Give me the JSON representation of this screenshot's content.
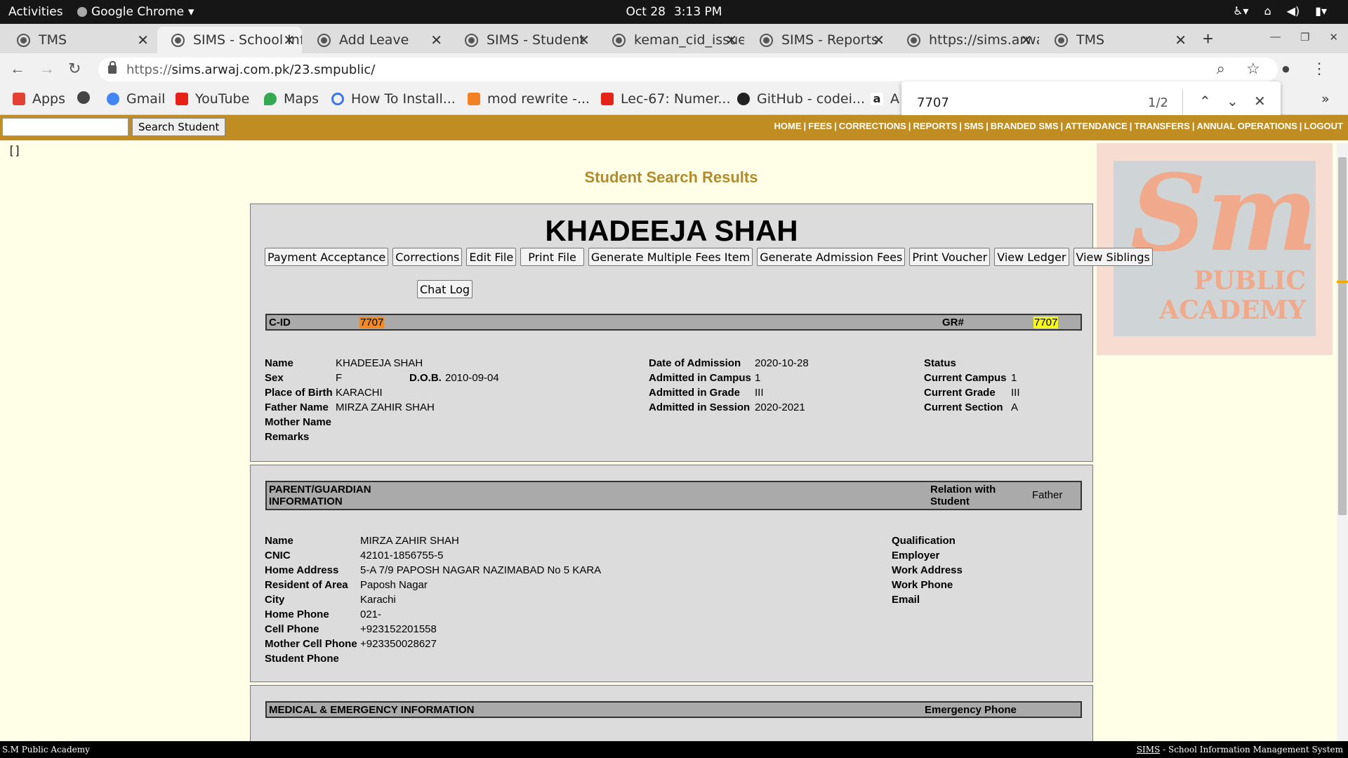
{
  "system": {
    "activities": "Activities",
    "app": "Google Chrome",
    "date": "Oct 28",
    "time": "3:13 PM"
  },
  "tabs": [
    {
      "title": "TMS"
    },
    {
      "title": "SIMS - School Information Management System"
    },
    {
      "title": "Add Leave"
    },
    {
      "title": "SIMS - Student"
    },
    {
      "title": "keman_cid_issue"
    },
    {
      "title": "SIMS - Reports"
    },
    {
      "title": "https://sims.arwaj"
    },
    {
      "title": "TMS"
    }
  ],
  "address": {
    "prefix": "https://",
    "url": "sims.arwaj.com.pk/23.smpublic/"
  },
  "bookmarks": [
    {
      "label": "Apps",
      "icon": "apps-grid-icon",
      "color": "#e34133"
    },
    {
      "label": "",
      "icon": "globe-icon",
      "color": "#444444"
    },
    {
      "label": "Gmail",
      "icon": "google-g-icon",
      "color": "#4285f4"
    },
    {
      "label": "YouTube",
      "icon": "youtube-icon",
      "color": "#e62117"
    },
    {
      "label": "Maps",
      "icon": "maps-pin-icon",
      "color": "#34a853"
    },
    {
      "label": "How To Install...",
      "icon": "loading-icon",
      "color": "#3b78e7"
    },
    {
      "label": "mod rewrite -...",
      "icon": "stack-icon",
      "color": "#f48024"
    },
    {
      "label": "Lec-67: Numer...",
      "icon": "youtube-icon",
      "color": "#e62117"
    },
    {
      "label": "GitHub - codei...",
      "icon": "github-icon",
      "color": "#222222"
    },
    {
      "label": "A",
      "icon": "amazon-icon",
      "color": "#222222"
    }
  ],
  "find": {
    "query": "7707",
    "count": "1/2"
  },
  "navbar": {
    "search_button": "Search Student",
    "links": [
      "HOME",
      "FEES",
      "CORRECTIONS",
      "REPORTS",
      "SMS",
      "BRANDED SMS",
      "ATTENDANCE",
      "TRANSFERS",
      "ANNUAL OPERATIONS",
      "LOGOUT"
    ]
  },
  "brackets": "[ ]",
  "logo": {
    "big": "Sm",
    "line1": "PUBLIC",
    "line2": "ACADEMY"
  },
  "page_title": "Student Search Results",
  "student": {
    "name": "KHADEEJA SHAH",
    "buttons": [
      "Payment Acceptance",
      "Corrections",
      "Edit File",
      "Print File",
      "Generate Multiple Fees Item",
      "Generate Admission Fees",
      "Print Voucher",
      "View Ledger",
      "View Siblings"
    ],
    "chat_log": "Chat Log",
    "cid_label": "C-ID",
    "cid": "7707",
    "gr_label": "GR#",
    "gr": "7707",
    "labels": {
      "name": "Name",
      "sex": "Sex",
      "dob": "D.O.B.",
      "pob": "Place of Birth",
      "father": "Father Name",
      "mother": "Mother Name",
      "remarks": "Remarks",
      "doa": "Date of Admission",
      "adm_campus": "Admitted in Campus",
      "adm_grade": "Admitted in Grade",
      "adm_session": "Admitted in Session",
      "status": "Status",
      "cur_campus": "Current Campus",
      "cur_grade": "Current Grade",
      "cur_section": "Current Section"
    },
    "values": {
      "name": "KHADEEJA SHAH",
      "sex": "F",
      "dob": "2010-09-04",
      "pob": "KARACHI",
      "father": "MIRZA ZAHIR SHAH",
      "doa": "2020-10-28",
      "adm_campus": "1",
      "adm_grade": "III",
      "adm_session": "2020-2021",
      "cur_campus": "1",
      "cur_grade": "III",
      "cur_section": "A"
    }
  },
  "guardian": {
    "header": "PARENT/GUARDIAN INFORMATION",
    "relation_label": "Relation with Student",
    "relation": "Father",
    "labels": {
      "name": "Name",
      "cnic": "CNIC",
      "address": "Home Address",
      "area": "Resident of Area",
      "city": "City",
      "home_phone": "Home Phone",
      "cell": "Cell Phone",
      "mother_cell": "Mother Cell Phone",
      "student_phone": "Student Phone",
      "qualification": "Qualification",
      "employer": "Employer",
      "work_address": "Work Address",
      "work_phone": "Work Phone",
      "email": "Email"
    },
    "values": {
      "name": "MIRZA ZAHIR SHAH",
      "cnic": "42101-1856755-5",
      "address": "5-A 7/9 PAPOSH NAGAR NAZIMABAD No 5 KARA",
      "area": "Paposh Nagar",
      "city": "Karachi",
      "home_phone": "021-",
      "cell": "+923152201558",
      "mother_cell": "+923350028627"
    }
  },
  "medical": {
    "header": "MEDICAL & EMERGENCY INFORMATION",
    "emergency_label": "Emergency Phone"
  },
  "footer": {
    "left": "S.M Public Academy",
    "sims": "SIMS",
    "right": " - School Information Management System"
  }
}
